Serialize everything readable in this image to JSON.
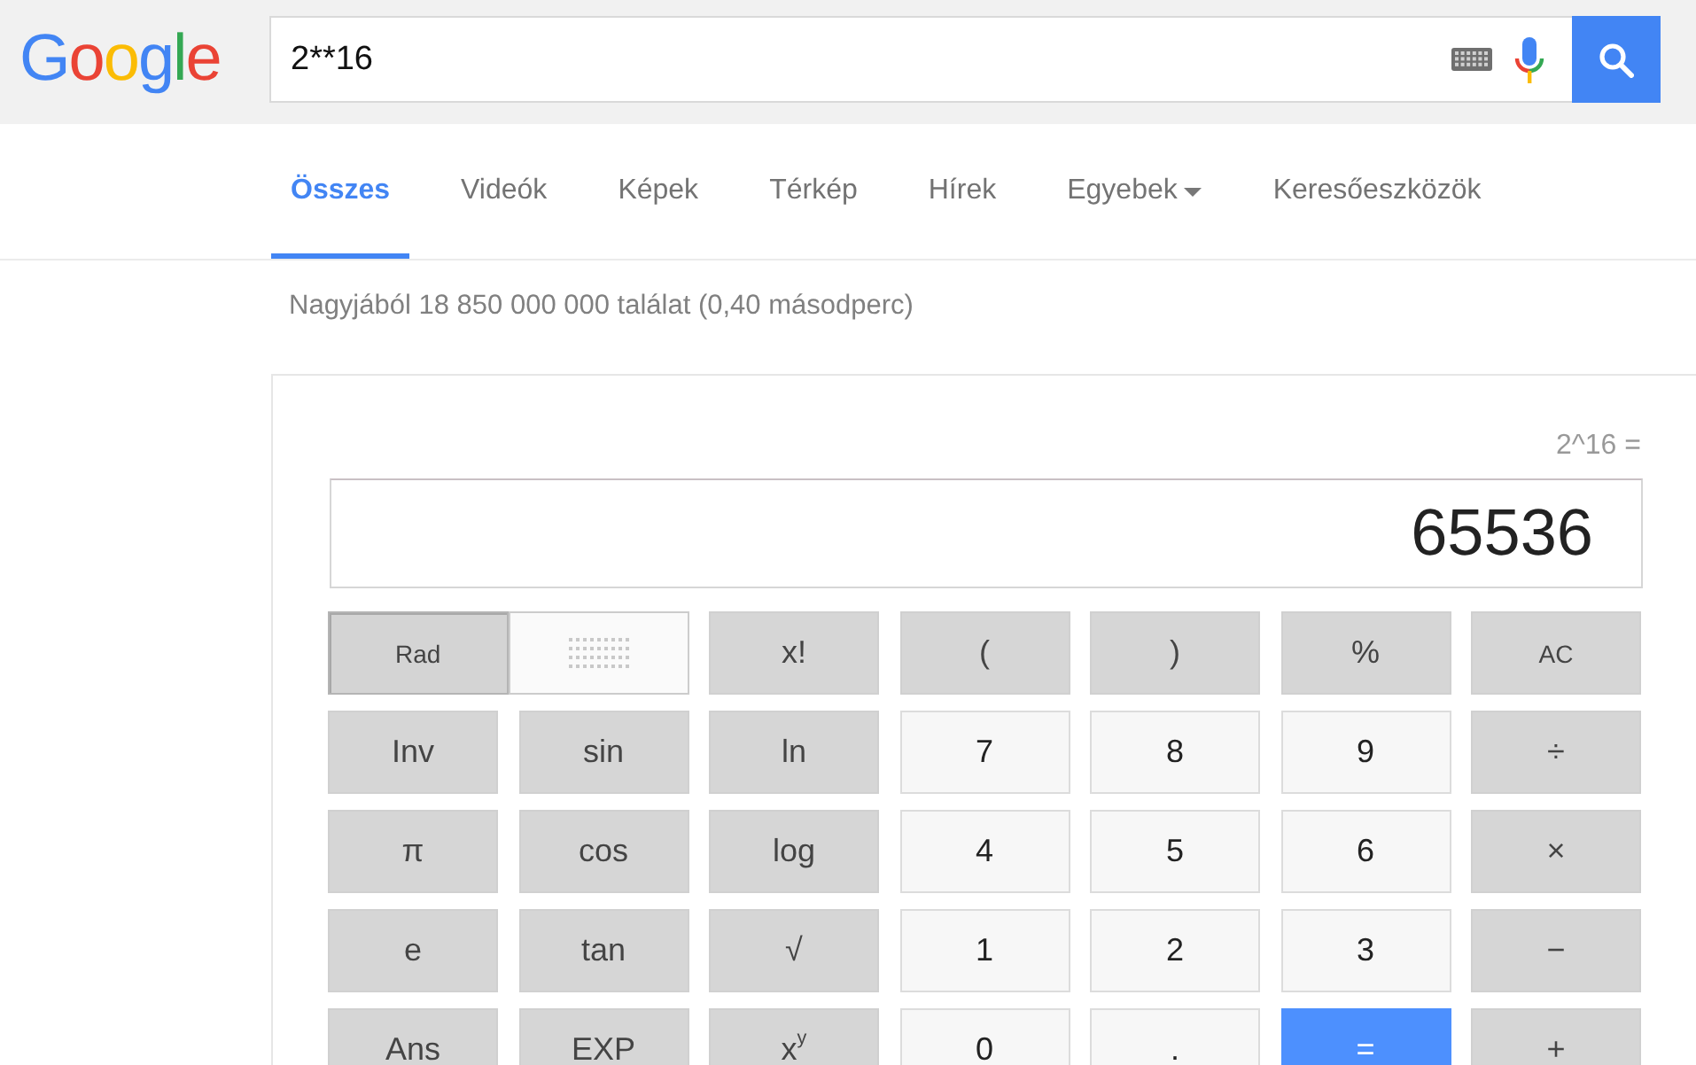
{
  "header": {
    "logo": "Google",
    "search": {
      "value": "2**16"
    }
  },
  "tabs": [
    {
      "label": "Összes",
      "selected": true,
      "kind": "tab"
    },
    {
      "label": "Videók",
      "selected": false,
      "kind": "tab"
    },
    {
      "label": "Képek",
      "selected": false,
      "kind": "tab"
    },
    {
      "label": "Térkép",
      "selected": false,
      "kind": "tab"
    },
    {
      "label": "Hírek",
      "selected": false,
      "kind": "tab"
    },
    {
      "label": "Egyebek",
      "selected": false,
      "kind": "dropdown"
    },
    {
      "label": "Keresőeszközök",
      "selected": false,
      "kind": "tab"
    }
  ],
  "result_stats": "Nagyjából 18 850 000 000 találat (0,40 másodperc)",
  "calculator": {
    "expression": "2^16 =",
    "result": "65536",
    "angle_mode": [
      {
        "label": "Rad",
        "selected": true
      },
      {
        "selected": false
      }
    ],
    "key_rows": [
      [
        {
          "label": "x!",
          "kind": "function"
        },
        {
          "label": "(",
          "kind": "function"
        },
        {
          "label": ")",
          "kind": "function"
        },
        {
          "label": "%",
          "kind": "function"
        },
        {
          "label": "AC",
          "kind": "clear"
        }
      ],
      [
        {
          "label": "Inv",
          "kind": "function"
        },
        {
          "label": "sin",
          "kind": "function"
        },
        {
          "label": "ln",
          "kind": "function"
        },
        {
          "label": "7",
          "kind": "digit"
        },
        {
          "label": "8",
          "kind": "digit"
        },
        {
          "label": "9",
          "kind": "digit"
        },
        {
          "label": "÷",
          "kind": "function"
        }
      ],
      [
        {
          "label": "π",
          "kind": "function"
        },
        {
          "label": "cos",
          "kind": "function"
        },
        {
          "label": "log",
          "kind": "function"
        },
        {
          "label": "4",
          "kind": "digit"
        },
        {
          "label": "5",
          "kind": "digit"
        },
        {
          "label": "6",
          "kind": "digit"
        },
        {
          "label": "×",
          "kind": "function"
        }
      ],
      [
        {
          "label": "e",
          "kind": "function"
        },
        {
          "label": "tan",
          "kind": "function"
        },
        {
          "label": "√",
          "kind": "function"
        },
        {
          "label": "1",
          "kind": "digit"
        },
        {
          "label": "2",
          "kind": "digit"
        },
        {
          "label": "3",
          "kind": "digit"
        },
        {
          "label": "−",
          "kind": "function"
        }
      ],
      [
        {
          "label": "Ans",
          "kind": "function"
        },
        {
          "label": "EXP",
          "kind": "function"
        },
        {
          "label": "x$^{y}$",
          "kind": "function"
        },
        {
          "label": "0",
          "kind": "digit"
        },
        {
          "label": ".",
          "kind": "digit"
        },
        {
          "label": "=",
          "kind": "equals"
        },
        {
          "label": "+",
          "kind": "function"
        }
      ]
    ]
  }
}
